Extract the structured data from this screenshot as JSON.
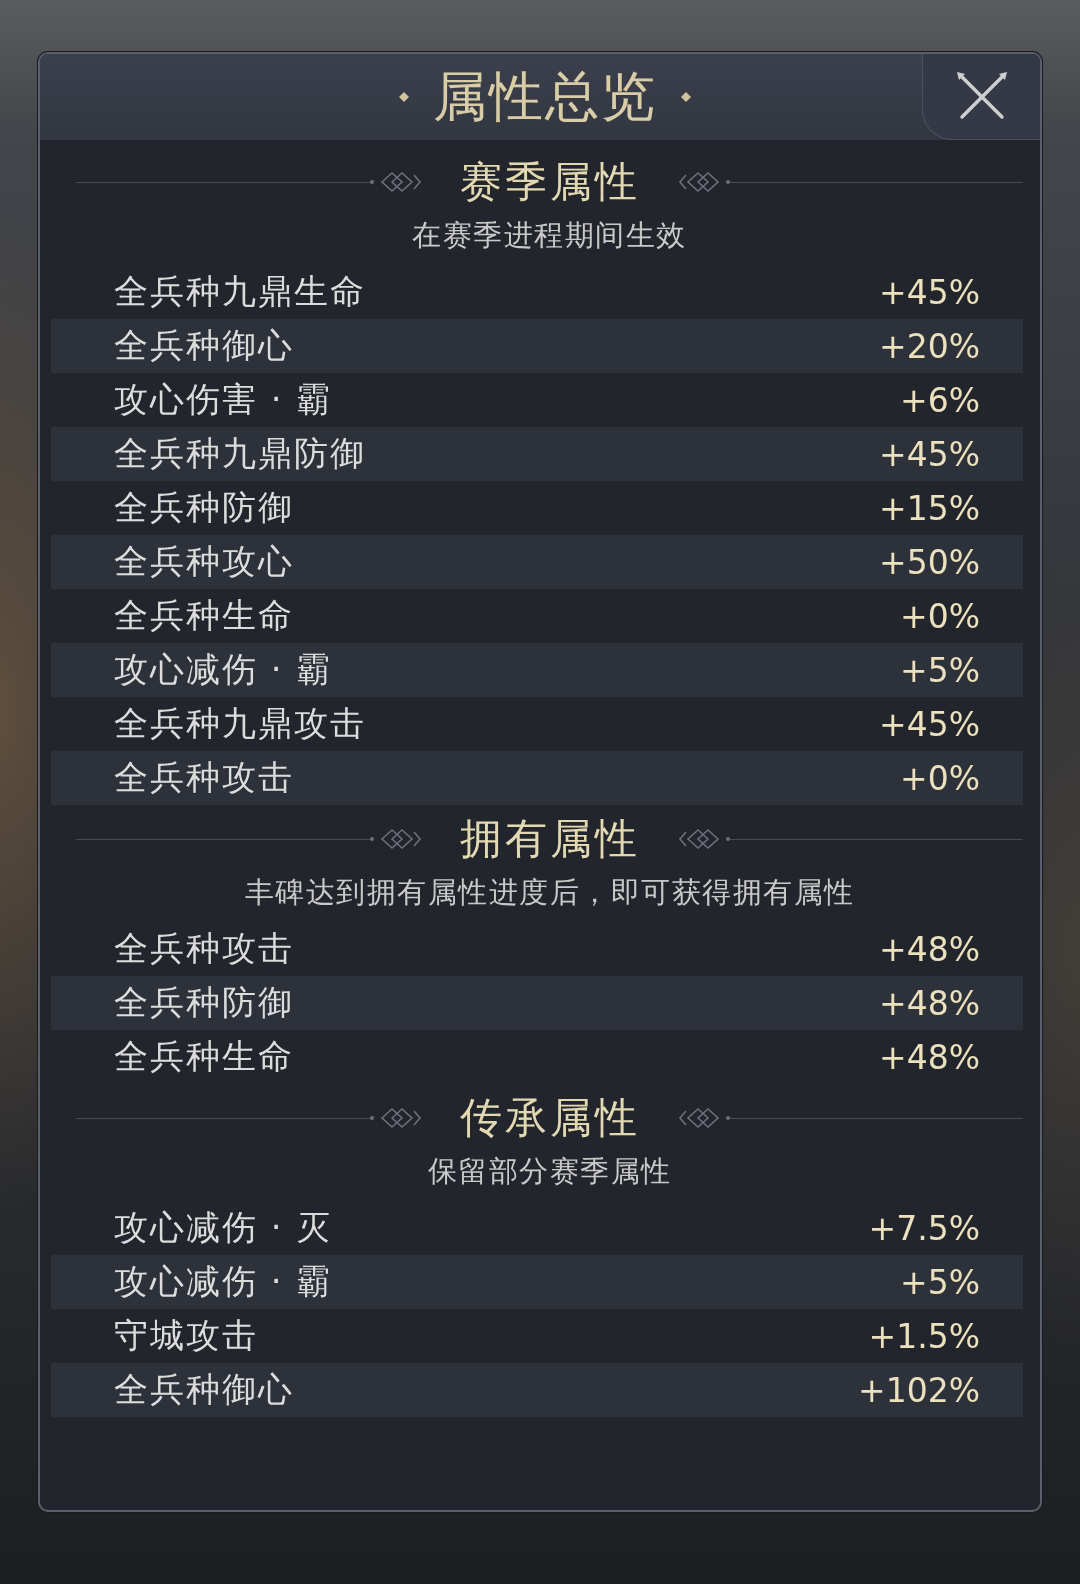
{
  "window": {
    "title": "属性总览"
  },
  "sections": [
    {
      "title": "赛季属性",
      "subtitle": "在赛季进程期间生效",
      "rows": [
        {
          "name": "全兵种九鼎生命",
          "value": "+45%"
        },
        {
          "name": "全兵种御心",
          "value": "+20%"
        },
        {
          "name": "攻心伤害 · 霸",
          "value": "+6%"
        },
        {
          "name": "全兵种九鼎防御",
          "value": "+45%"
        },
        {
          "name": "全兵种防御",
          "value": "+15%"
        },
        {
          "name": "全兵种攻心",
          "value": "+50%"
        },
        {
          "name": "全兵种生命",
          "value": "+0%"
        },
        {
          "name": "攻心减伤 · 霸",
          "value": "+5%"
        },
        {
          "name": "全兵种九鼎攻击",
          "value": "+45%"
        },
        {
          "name": "全兵种攻击",
          "value": "+0%"
        }
      ]
    },
    {
      "title": "拥有属性",
      "subtitle": "丰碑达到拥有属性进度后，即可获得拥有属性",
      "rows": [
        {
          "name": "全兵种攻击",
          "value": "+48%"
        },
        {
          "name": "全兵种防御",
          "value": "+48%"
        },
        {
          "name": "全兵种生命",
          "value": "+48%"
        }
      ]
    },
    {
      "title": "传承属性",
      "subtitle": "保留部分赛季属性",
      "rows": [
        {
          "name": "攻心减伤 · 灭",
          "value": "+7.5%"
        },
        {
          "name": "攻心减伤 · 霸",
          "value": "+5%"
        },
        {
          "name": "守城攻击",
          "value": "+1.5%"
        },
        {
          "name": "全兵种御心",
          "value": "+102%"
        }
      ]
    }
  ]
}
